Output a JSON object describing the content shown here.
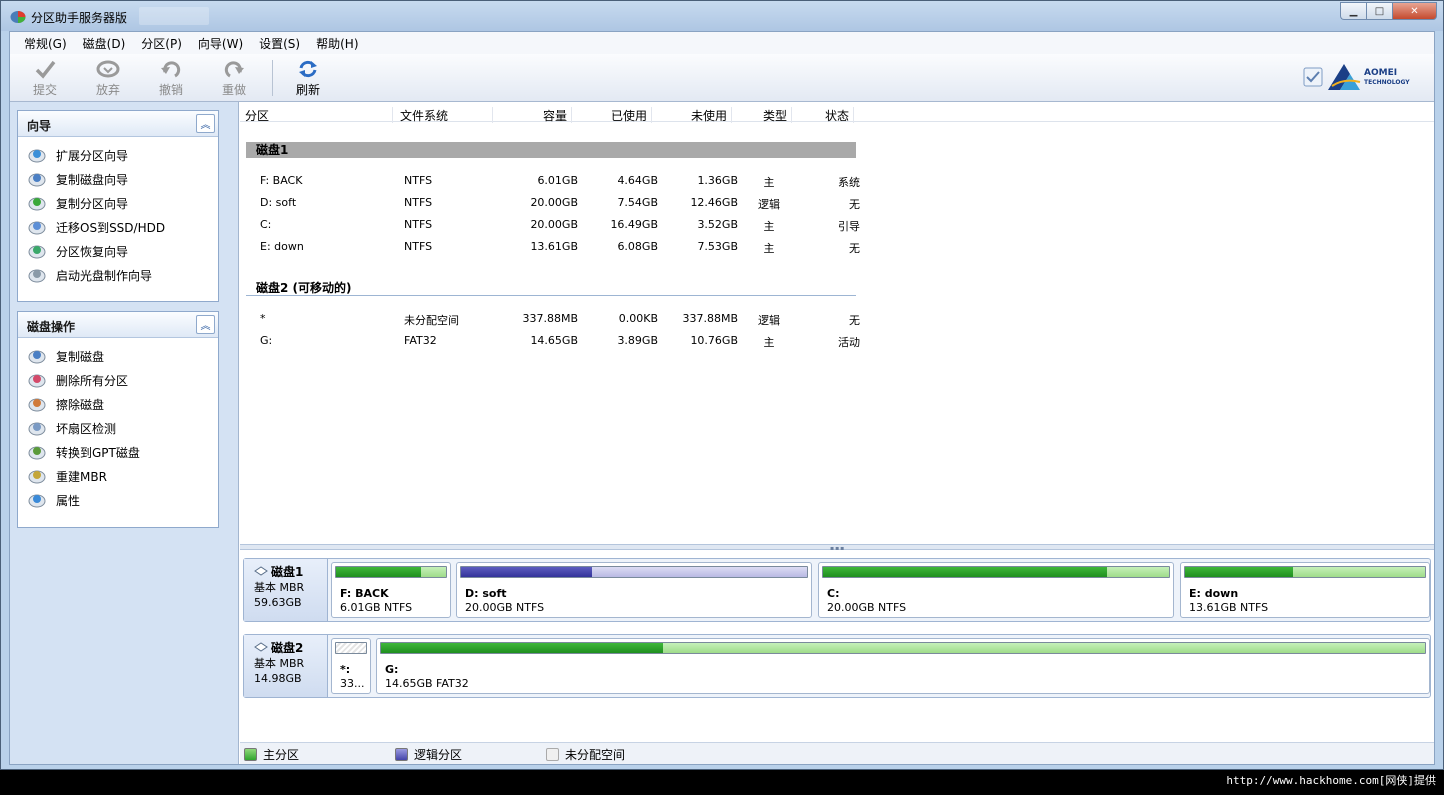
{
  "window": {
    "title": "分区助手服务器版",
    "buttons": {
      "minimize": "▁",
      "maximize": "□",
      "close": "✕"
    }
  },
  "menu": [
    "常规(G)",
    "磁盘(D)",
    "分区(P)",
    "向导(W)",
    "设置(S)",
    "帮助(H)"
  ],
  "toolbar": {
    "commit": "提交",
    "discard": "放弃",
    "undo": "撤销",
    "redo": "重做",
    "refresh": "刷新",
    "brand": "AOMEI",
    "brand_sub": "TECHNOLOGY"
  },
  "sidebar": {
    "wizards": {
      "title": "向导",
      "items": [
        {
          "label": "扩展分区向导",
          "icon": "extend-partition-icon"
        },
        {
          "label": "复制磁盘向导",
          "icon": "copy-disk-icon"
        },
        {
          "label": "复制分区向导",
          "icon": "copy-partition-icon"
        },
        {
          "label": "迁移OS到SSD/HDD",
          "icon": "migrate-os-icon"
        },
        {
          "label": "分区恢复向导",
          "icon": "partition-recovery-icon"
        },
        {
          "label": "启动光盘制作向导",
          "icon": "boot-cd-icon"
        }
      ]
    },
    "disk_ops": {
      "title": "磁盘操作",
      "items": [
        {
          "label": "复制磁盘",
          "icon": "copy-disk-icon"
        },
        {
          "label": "删除所有分区",
          "icon": "delete-all-icon"
        },
        {
          "label": "擦除磁盘",
          "icon": "wipe-disk-icon"
        },
        {
          "label": "坏扇区检测",
          "icon": "bad-sector-icon"
        },
        {
          "label": "转换到GPT磁盘",
          "icon": "convert-gpt-icon"
        },
        {
          "label": "重建MBR",
          "icon": "rebuild-mbr-icon"
        },
        {
          "label": "属性",
          "icon": "properties-icon"
        }
      ]
    }
  },
  "columns": [
    "分区",
    "文件系统",
    "容量",
    "已使用",
    "未使用",
    "类型",
    "状态"
  ],
  "disks": [
    {
      "title": "磁盘1",
      "rows": [
        {
          "partition": "F: BACK",
          "fs": "NTFS",
          "capacity": "6.01GB",
          "used": "4.64GB",
          "free": "1.36GB",
          "type": "主",
          "status": "系统"
        },
        {
          "partition": "D: soft",
          "fs": "NTFS",
          "capacity": "20.00GB",
          "used": "7.54GB",
          "free": "12.46GB",
          "type": "逻辑",
          "status": "无"
        },
        {
          "partition": "C:",
          "fs": "NTFS",
          "capacity": "20.00GB",
          "used": "16.49GB",
          "free": "3.52GB",
          "type": "主",
          "status": "引导"
        },
        {
          "partition": "E: down",
          "fs": "NTFS",
          "capacity": "13.61GB",
          "used": "6.08GB",
          "free": "7.53GB",
          "type": "主",
          "status": "无"
        }
      ]
    },
    {
      "title": "磁盘2 (可移动的)",
      "rows": [
        {
          "partition": "*",
          "fs": "未分配空间",
          "capacity": "337.88MB",
          "used": "0.00KB",
          "free": "337.88MB",
          "type": "逻辑",
          "status": "无"
        },
        {
          "partition": "G:",
          "fs": "FAT32",
          "capacity": "14.65GB",
          "used": "3.89GB",
          "free": "10.76GB",
          "type": "主",
          "status": "活动"
        }
      ]
    }
  ],
  "diskmap": [
    {
      "name": "磁盘1",
      "kind": "基本 MBR",
      "size": "59.63GB",
      "parts": [
        {
          "name": "F: BACK",
          "info": "6.01GB NTFS",
          "kind": "primary",
          "used": 0.77
        },
        {
          "name": "D: soft",
          "info": "20.00GB NTFS",
          "kind": "logical",
          "used": 0.38
        },
        {
          "name": "C:",
          "info": "20.00GB NTFS",
          "kind": "primary",
          "used": 0.82
        },
        {
          "name": "E: down",
          "info": "13.61GB NTFS",
          "kind": "primary",
          "used": 0.45
        }
      ]
    },
    {
      "name": "磁盘2",
      "kind": "基本 MBR",
      "size": "14.98GB",
      "parts": [
        {
          "name": "*:",
          "info": "33...",
          "kind": "unalloc",
          "used": 0
        },
        {
          "name": "G:",
          "info": "14.65GB FAT32",
          "kind": "primary",
          "used": 0.27
        }
      ]
    }
  ],
  "legend": [
    "主分区",
    "逻辑分区",
    "未分配空间"
  ],
  "colors": {
    "primary": "#2fa52d",
    "logical": "#4444aa",
    "unallocated": "#f0f0f0"
  },
  "watermark": "http://www.hackhome.com[网侠]提供"
}
